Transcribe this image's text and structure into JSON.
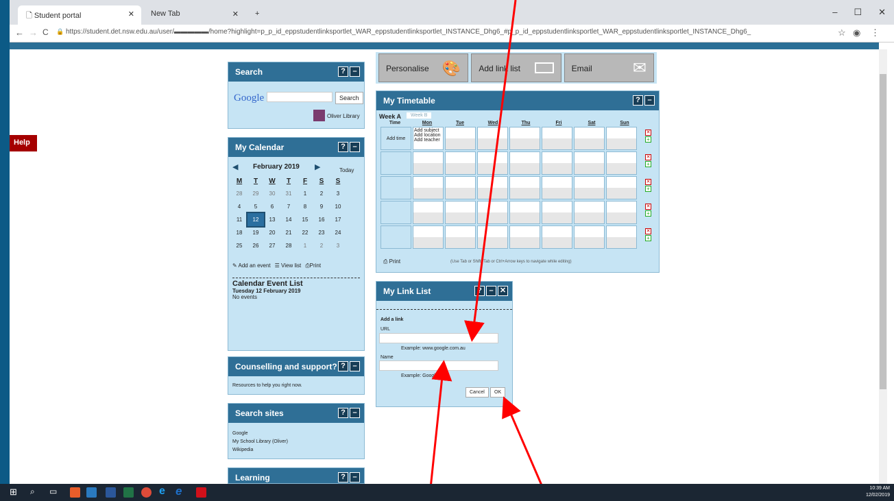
{
  "browser": {
    "tabs": [
      {
        "title": "Student portal"
      },
      {
        "title": "New Tab"
      }
    ],
    "url": "https://student.det.nsw.edu.au/user/▬▬▬▬▬/home?highlight=p_p_id_eppstudentlinksportlet_WAR_eppstudentlinksportlet_INSTANCE_Dhg6_#p_p_id_eppstudentlinksportlet_WAR_eppstudentlinksportlet_INSTANCE_Dhg6_",
    "window_controls": [
      "–",
      "☐",
      "✕"
    ]
  },
  "help_label": "Help",
  "search": {
    "title": "Search",
    "google_logo": "Google",
    "button": "Search",
    "library": "Oliver Library"
  },
  "calendar": {
    "title": "My Calendar",
    "month": "February 2019",
    "today_label": "Today",
    "weekdays": [
      "M",
      "T",
      "W",
      "T",
      "F",
      "S",
      "S"
    ],
    "weeks": [
      [
        "28",
        "29",
        "30",
        "31",
        "1",
        "2",
        "3"
      ],
      [
        "4",
        "5",
        "6",
        "7",
        "8",
        "9",
        "10"
      ],
      [
        "11",
        "12",
        "13",
        "14",
        "15",
        "16",
        "17"
      ],
      [
        "18",
        "19",
        "20",
        "21",
        "22",
        "23",
        "24"
      ],
      [
        "25",
        "26",
        "27",
        "28",
        "1",
        "2",
        "3"
      ]
    ],
    "add_event": "Add an event",
    "view_list": "View list",
    "print": "Print",
    "event_list_title": "Calendar Event List",
    "event_date": "Tuesday 12 February 2019",
    "no_events": "No events"
  },
  "counselling": {
    "title": "Counselling and support?",
    "text": "Resources to help you right now."
  },
  "search_sites": {
    "title": "Search sites",
    "links": [
      "Google",
      "My School Library (Oliver)",
      "Wikipedia"
    ]
  },
  "learning": {
    "title": "Learning"
  },
  "top_buttons": {
    "personalise": "Personalise",
    "add_link_list": "Add link list",
    "email": "Email"
  },
  "timetable": {
    "title": "My Timetable",
    "week_a": "Week A",
    "week_b": "Week B",
    "headers": [
      "Time",
      "Mon",
      "Tue",
      "Wed",
      "Thu",
      "Fri",
      "Sat",
      "Sun"
    ],
    "add_time": "Add time",
    "add_subject": "Add subject",
    "add_location": "Add location",
    "add_teacher": "Add teacher",
    "print": "Print",
    "hint": "(Use Tab or Shift+Tab or Ctrl+Arrow keys to navigate while editing)"
  },
  "link_list": {
    "title": "My Link List",
    "add_link": "Add a link",
    "url_label": "URL",
    "url_example": "Example: www.google.com.au",
    "name_label": "Name",
    "name_example": "Example: Google",
    "cancel": "Cancel",
    "ok": "OK"
  },
  "taskbar": {
    "time": "10:39 AM",
    "date": "12/02/2019"
  },
  "colors": {
    "portlet_header": "#2f6f96",
    "portlet_body": "#c6e4f4",
    "help": "#a50000",
    "annotation_arrow": "#ff0000"
  }
}
